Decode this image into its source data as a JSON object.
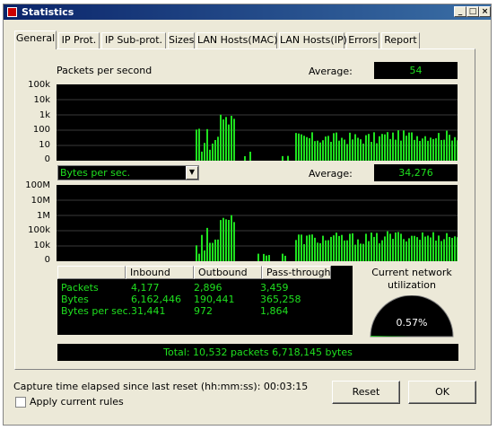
{
  "window": {
    "title": "Statistics",
    "minimize": "_",
    "maximize": "□",
    "close": "×"
  },
  "tabs": [
    "General",
    "IP Prot.",
    "IP Sub-prot.",
    "Sizes",
    "LAN Hosts(MAC)",
    "LAN Hosts(IP)",
    "Errors",
    "Report"
  ],
  "active_tab": "General",
  "packets": {
    "label": "Packets per second",
    "average_label": "Average:",
    "average_value": "54",
    "ticks": [
      "100k",
      "10k",
      "1k",
      "100",
      "10",
      "0"
    ]
  },
  "bytes": {
    "selector_value": "Bytes per sec.",
    "average_label": "Average:",
    "average_value": "34,276",
    "ticks": [
      "100M",
      "10M",
      "1M",
      "100k",
      "10k",
      "0"
    ]
  },
  "table": {
    "headers": [
      "",
      "Inbound",
      "Outbound",
      "Pass-through"
    ],
    "rows": [
      {
        "label": "Packets",
        "inbound": "4,177",
        "outbound": "2,896",
        "pass": "3,459"
      },
      {
        "label": "Bytes",
        "inbound": "6,162,446",
        "outbound": "190,441",
        "pass": "365,258"
      },
      {
        "label": "Bytes per sec.",
        "inbound": "31,441",
        "outbound": "972",
        "pass": "1,864"
      }
    ]
  },
  "utilization": {
    "label_line1": "Current network",
    "label_line2": "utilization",
    "value": "0.57%",
    "fraction": 0.0057
  },
  "total": "Total: 10,532 packets 6,718,145 bytes",
  "footer": {
    "capture_label": "Capture time elapsed since last reset (hh:mm:ss): 00:03:15",
    "apply_rules": "Apply current rules",
    "reset": "Reset",
    "ok": "OK"
  },
  "colors": {
    "graph_bg": "#000000",
    "graph_fg": "#1fe01f",
    "titlebar": "#0a246a"
  }
}
